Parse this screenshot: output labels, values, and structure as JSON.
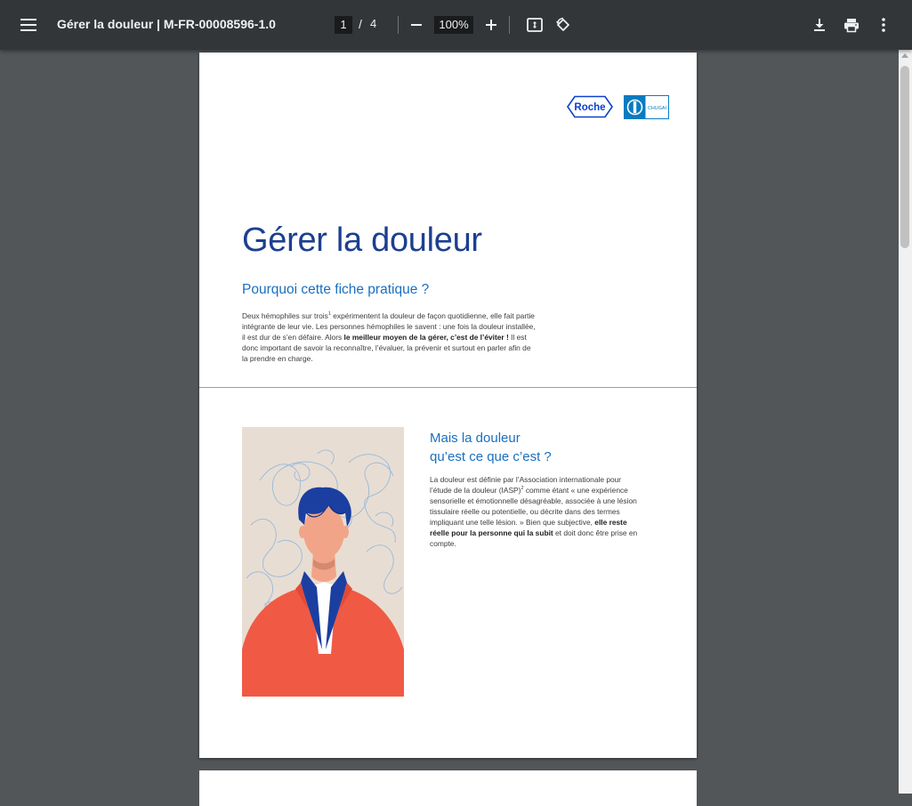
{
  "toolbar": {
    "title": "Gérer la douleur | M-FR-00008596-1.0",
    "page_current": "1",
    "page_separator": "/",
    "page_total": "4",
    "zoom": "100%"
  },
  "page": {
    "logos": {
      "roche": "Roche",
      "chugai": "CHUGAI"
    },
    "title": "Gérer la douleur",
    "subtitle": "Pourquoi cette fiche pratique ?",
    "intro": {
      "p1": "Deux hémophiles sur trois",
      "sup1": "1",
      "p2": " expérimentent la douleur de façon quotidienne, elle fait partie intégrante de leur vie. Les personnes hémophiles le savent : une fois la douleur installée, il est dur de s’en défaire. Alors ",
      "bold": "le meilleur moyen de la gérer, c’est de l’éviter !",
      "p3": " Il est donc important de savoir la reconnaître, l’évaluer, la prévenir et surtout en parler afin de la prendre en charge."
    },
    "section": {
      "title_line1": "Mais la douleur",
      "title_line2": "qu’est ce que c’est ?",
      "p1": "La douleur est définie par l’Association internationale pour l’étude de la douleur (IASP)",
      "sup": "2",
      "p2": " comme étant « une expérience sensorielle et émotionnelle désagréable, associée à une lésion tissulaire réelle ou potentielle, ou décrite dans des termes impliquant une telle lésion. » Bien que subjective, ",
      "bold": "elle reste réelle pour la personne qui la subit",
      "p3": " et doit donc être prise en compte."
    }
  },
  "icons": [
    "menu-icon",
    "minus-icon",
    "plus-icon",
    "fit-page-icon",
    "rotate-icon",
    "download-icon",
    "print-icon",
    "more-vert-icon"
  ],
  "colors": {
    "toolbar_bg": "#323639",
    "viewer_bg": "#525659",
    "title_blue": "#1c3f8f",
    "subtitle_blue": "#1a6fbf",
    "roche_blue": "#0b41cd",
    "chugai_blue": "#0a7bc1",
    "jacket_red": "#f05a45",
    "hair_blue": "#1b3fa0"
  }
}
